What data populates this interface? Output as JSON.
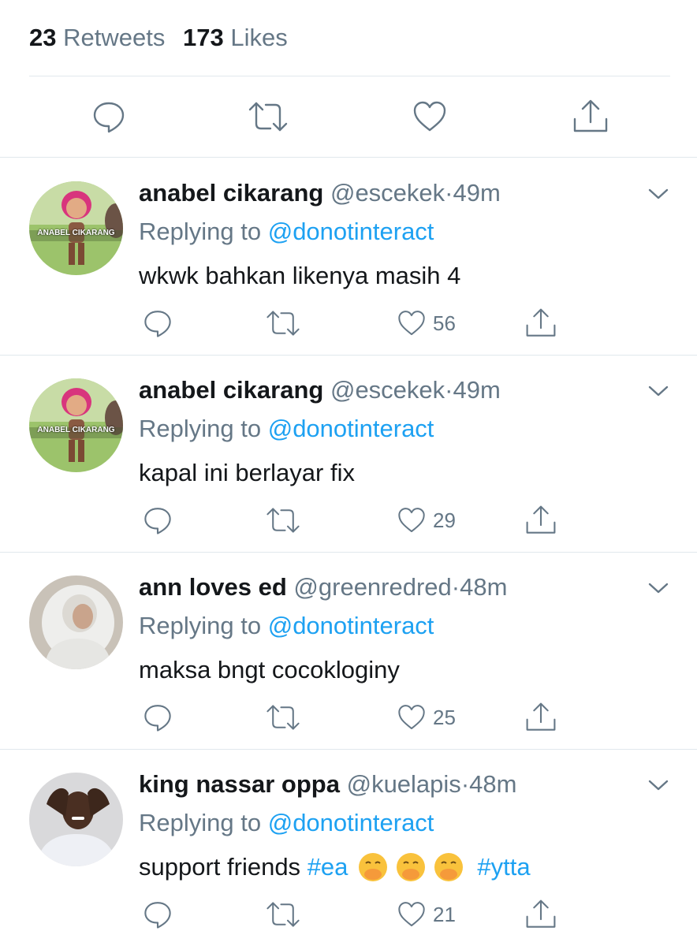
{
  "stats": {
    "retweets_count": "23",
    "retweets_label": "Retweets",
    "likes_count": "173",
    "likes_label": "Likes"
  },
  "main_actions": [
    "reply-icon",
    "retweet-icon",
    "like-icon",
    "share-icon"
  ],
  "colors": {
    "link": "#1da1f2",
    "muted": "#657786",
    "text": "#14171a",
    "divider": "#e1e8ed"
  },
  "replies": [
    {
      "name": "anabel cikarang",
      "handle": "@escekek",
      "dot": "·",
      "time": "49m",
      "replying_prefix": "Replying to",
      "replying_to": "@donotinteract",
      "text": "wkwk bahkan likenya masih 4",
      "likes": "56",
      "avatar_label": "ANABEL CIKARANG"
    },
    {
      "name": "anabel cikarang",
      "handle": "@escekek",
      "dot": "·",
      "time": "49m",
      "replying_prefix": "Replying to",
      "replying_to": "@donotinteract",
      "text": "kapal ini berlayar fix",
      "likes": "29",
      "avatar_label": "ANABEL CIKARANG"
    },
    {
      "name": "ann loves ed",
      "handle": "@greenredred",
      "dot": "·",
      "time": "48m",
      "replying_prefix": "Replying to",
      "replying_to": "@donotinteract",
      "text": "maksa bngt cocokloginy",
      "likes": "25"
    },
    {
      "name": "king nassar oppa",
      "handle": "@kuelapis",
      "dot": "·",
      "time": "48m",
      "replying_prefix": "Replying to",
      "replying_to": "@donotinteract",
      "text_parts": [
        "support friends",
        "#ea",
        "#ytta"
      ],
      "likes": "21"
    }
  ]
}
